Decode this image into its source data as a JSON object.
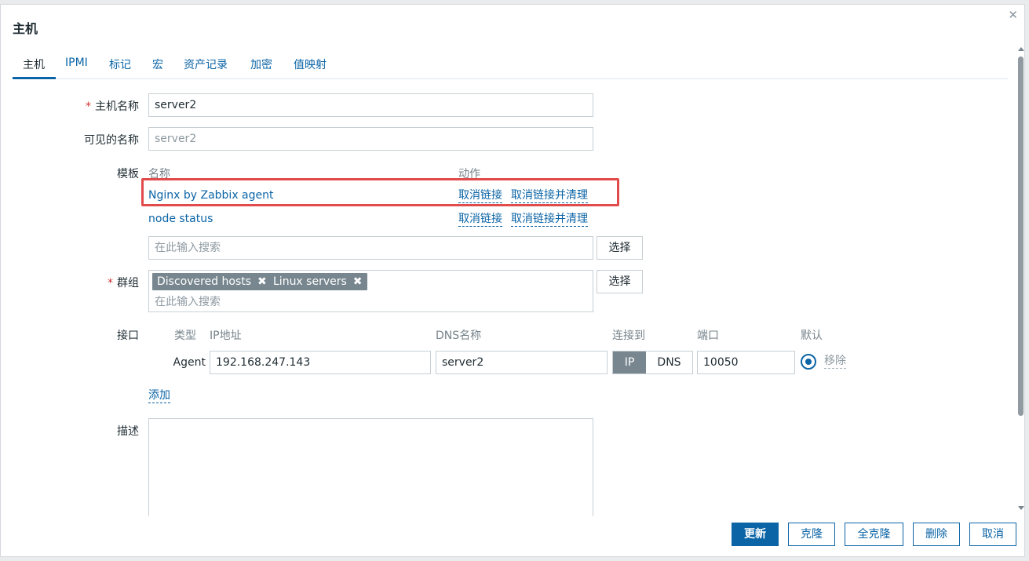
{
  "dialog": {
    "title": "主机",
    "close_icon": "✕"
  },
  "tabs": [
    {
      "label": "主机"
    },
    {
      "label": "IPMI"
    },
    {
      "label": "标记"
    },
    {
      "label": "宏"
    },
    {
      "label": "资产记录"
    },
    {
      "label": "加密"
    },
    {
      "label": "值映射"
    }
  ],
  "form": {
    "host_name": {
      "required_mark": "*",
      "label": "主机名称",
      "value": "server2"
    },
    "visible_name": {
      "label": "可见的名称",
      "placeholder": "server2"
    },
    "templates": {
      "label": "模板",
      "col_name": "名称",
      "col_action": "动作",
      "rows": [
        {
          "name": "Nginx by Zabbix agent",
          "unlink": "取消链接",
          "unlink_clear": "取消链接并清理"
        },
        {
          "name": "node status",
          "unlink": "取消链接",
          "unlink_clear": "取消链接并清理"
        }
      ],
      "search_placeholder": "在此输入搜索",
      "select_label": "选择"
    },
    "groups": {
      "required_mark": "*",
      "label": "群组",
      "chips": [
        {
          "label": "Discovered hosts",
          "remove_icon": "✖"
        },
        {
          "label": "Linux servers",
          "remove_icon": "✖"
        }
      ],
      "search_placeholder": "在此输入搜索",
      "select_label": "选择"
    },
    "interfaces": {
      "label": "接口",
      "headers": {
        "type": "类型",
        "ip": "IP地址",
        "dns": "DNS名称",
        "connect": "连接到",
        "port": "端口",
        "default": "默认"
      },
      "row": {
        "type": "Agent",
        "ip": "192.168.247.143",
        "dns": "server2",
        "connect_ip": "IP",
        "connect_dns": "DNS",
        "port": "10050",
        "remove": "移除"
      },
      "add_label": "添加"
    },
    "description": {
      "label": "描述"
    }
  },
  "footer": {
    "update": "更新",
    "clone": "克隆",
    "full_clone": "全克隆",
    "delete": "删除",
    "cancel": "取消"
  },
  "colors": {
    "accent": "#0b64a6",
    "highlight": "#e24b4b",
    "chip": "#78878f"
  }
}
